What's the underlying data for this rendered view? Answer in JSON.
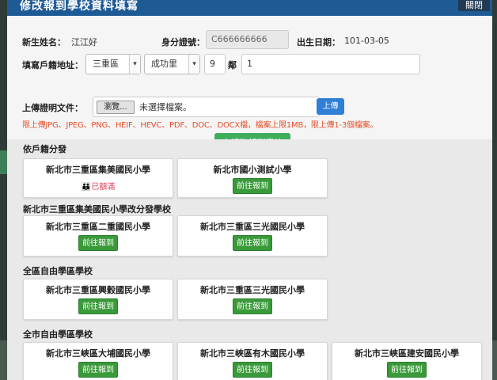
{
  "header": {
    "title": "修改報到學校資料填寫",
    "close_label": "關閉"
  },
  "form": {
    "name_label": "新生姓名：",
    "name_value": "江江好",
    "id_label": "身分證號：",
    "id_value": "C666666666",
    "birth_label": "出生日期：",
    "birth_value": "101-03-05",
    "address_label": "填寫戶籍地址：",
    "district": "三重區",
    "village": "成功里",
    "neighborhood": "9",
    "neighborhood_unit": "鄰",
    "address_rest": "1",
    "upload_label": "上傳證明文件：",
    "browse_label": "瀏覽...",
    "no_file_text": "未選擇檔案。",
    "upload_button": "上傳",
    "upload_warning": "限上傳JPG、JPEG、PNG、HEIF、HEVC、PDF、DOC、DOCX檔，檔案上限1MB，限上傳1-3個檔案。",
    "apply_button": "申請改報到學校"
  },
  "sections": [
    {
      "title": "依戶籍分發",
      "schools": [
        {
          "name": "新北市三重區集美國民小學",
          "status": "已額滿"
        },
        {
          "name": "新北市國小測試小學",
          "action": "前往報到"
        }
      ]
    },
    {
      "title": "新北市三重區集美國民小學改分發學校",
      "schools": [
        {
          "name": "新北市三重區二重國民小學",
          "action": "前往報到"
        },
        {
          "name": "新北市三重區三光國民小學",
          "action": "前往報到"
        }
      ]
    },
    {
      "title": "全區自由學區學校",
      "schools": [
        {
          "name": "新北市三重區興穀國民小學",
          "action": "前往報到"
        },
        {
          "name": "新北市三重區三光國民小學",
          "action": "前往報到"
        }
      ]
    },
    {
      "title": "全市自由學區學校",
      "schools": [
        {
          "name": "新北市三峽區大埔國民小學",
          "action": "前往報到"
        },
        {
          "name": "新北市三峽區有木國民小學",
          "action": "前往報到"
        },
        {
          "name": "新北市三峽區建安國民小學",
          "action": "前往報到"
        }
      ]
    }
  ],
  "colors": {
    "header_bg": "#1e5b95",
    "go_button": "#3a9a3a",
    "apply_button": "#3fae5a",
    "upload_button": "#2f7fd6",
    "warning_text": "#e4502b",
    "full_text": "#e0405a"
  }
}
